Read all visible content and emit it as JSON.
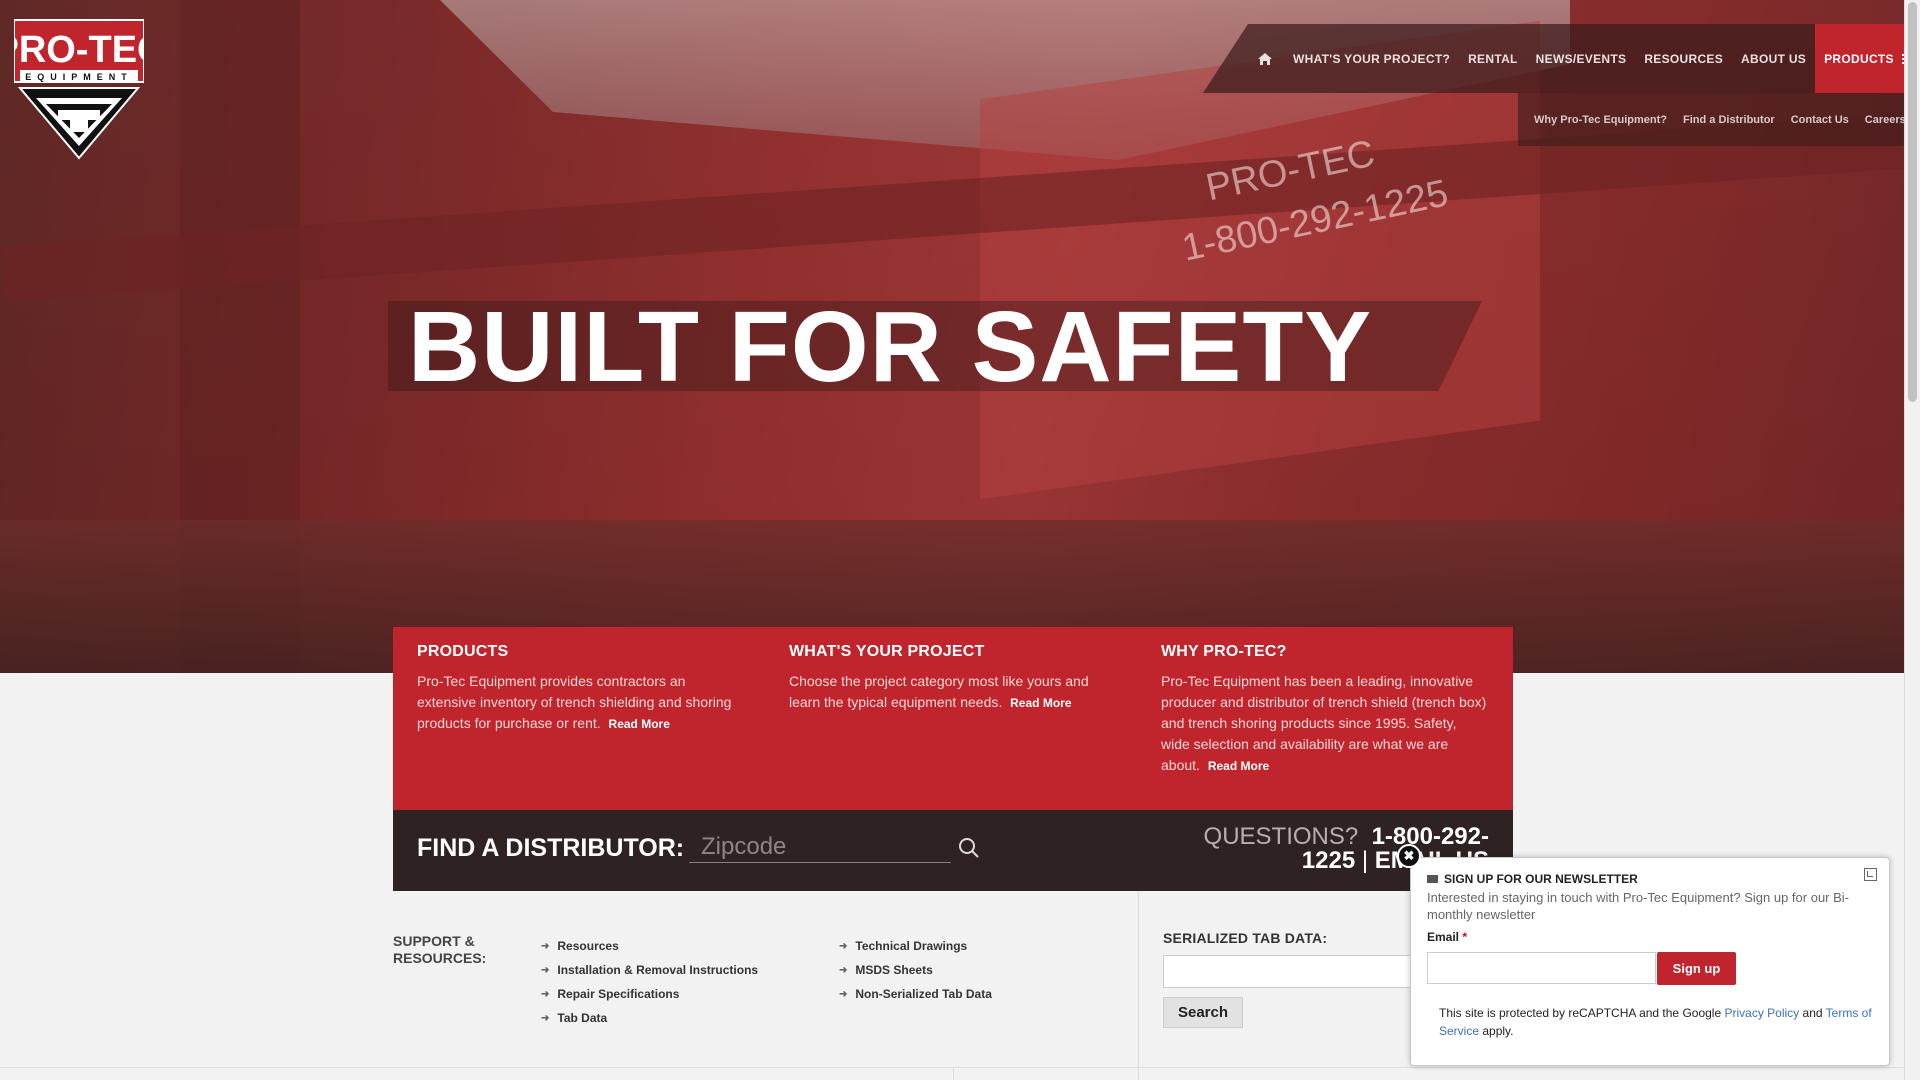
{
  "brand": {
    "name": "PRO-TEC",
    "tagline": "EQUIPMENT"
  },
  "nav": {
    "home_icon": "home-icon",
    "items": [
      "WHAT'S YOUR PROJECT?",
      "RENTAL",
      "NEWS/EVENTS",
      "RESOURCES",
      "ABOUT US"
    ],
    "products": "PRODUCTS",
    "sub_items": [
      "Why Pro-Tec Equipment?",
      "Find a Distributor",
      "Contact Us",
      "Careers"
    ]
  },
  "hero": {
    "headline": "BUILT FOR SAFETY",
    "paint_text": [
      "PRO-TEC",
      "1-800-292-1225"
    ]
  },
  "cards": [
    {
      "title": "PRODUCTS",
      "text": "Pro-Tec Equipment provides contractors an extensive inventory of trench shielding and shoring products for purchase or rent.",
      "more": "Read More"
    },
    {
      "title": "WHAT'S YOUR PROJECT",
      "text": "Choose the project category most like yours and learn the typical equipment needs.",
      "more": "Read More"
    },
    {
      "title": "WHY PRO-TEC?",
      "text": "Pro-Tec Equipment has been a leading, innovative producer and distributor of trench shield (trench box) and trench shoring products since 1995. Safety, wide selection and availability are what we are about.",
      "more": "Read More"
    }
  ],
  "distributor": {
    "label": "FIND A DISTRIBUTOR:",
    "placeholder": "Zipcode",
    "questions": "QUESTIONS?",
    "phone": "1-800-292-",
    "phone2": "1225",
    "separator": "|",
    "email": "EMAIL US"
  },
  "support": {
    "heading": "SUPPORT & RESOURCES:",
    "col1": [
      "Resources",
      "Installation & Removal Instructions",
      "Repair Specifications",
      "Tab Data"
    ],
    "col2": [
      "Technical Drawings",
      "MSDS Sheets",
      "Non-Serialized Tab Data"
    ]
  },
  "serialized": {
    "label": "SERIALIZED TAB DATA:",
    "button": "Search"
  },
  "newsletter": {
    "title": "SIGN UP FOR OUR NEWSLETTER",
    "description": "Interested in staying in touch with Pro-Tec Equipment? Sign up for our Bi-monthly newsletter",
    "email_label": "Email",
    "required_mark": "*",
    "button": "Sign up",
    "captcha_pre": "This site is protected by reCAPTCHA and the Google",
    "privacy": "Privacy Policy",
    "and": "and",
    "terms": "Terms of Service",
    "apply": "apply.",
    "close_icon": "close-icon",
    "minimize_icon": "minimize-icon"
  },
  "colors": {
    "brand_red": "#c0242c",
    "dark_bar": "#2f2222"
  }
}
